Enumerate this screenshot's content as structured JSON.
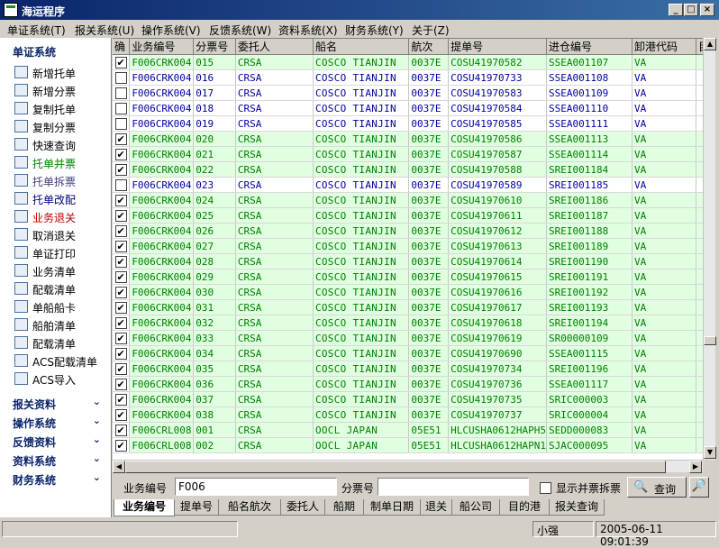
{
  "window": {
    "title": "海运程序"
  },
  "menu": [
    "单证系统(T)",
    "报关系统(U)",
    "操作系统(V)",
    "反馈系统(W)",
    "资料系统(X)",
    "财务系统(Y)",
    "关于(Z)"
  ],
  "sidebar": {
    "section_main": "单证系统",
    "items": [
      "新增托单",
      "新增分票",
      "复制托单",
      "复制分票",
      "快速查询",
      "托单并票",
      "托单拆票",
      "托单改配",
      "业务退关",
      "取消退关",
      "单证打印",
      "业务清单",
      "配载清单",
      "单船船卡",
      "船舶清单",
      "配载清单",
      "ACS配载清单",
      "ACS导入"
    ],
    "item_colors": [
      "#000000",
      "#000000",
      "#000000",
      "#000000",
      "#000000",
      "#008000",
      "#404080",
      "#000080",
      "#c00000",
      "#000000",
      "#000000",
      "#000000",
      "#000000",
      "#000000",
      "#000000",
      "#000000",
      "#000000",
      "#000000"
    ],
    "sections": [
      "报关资料",
      "操作系统",
      "反馈资料",
      "资料系统",
      "财务系统"
    ]
  },
  "grid": {
    "columns": [
      "确",
      "业务编号",
      "分票号",
      "委托人",
      "船名",
      "航次",
      "提单号",
      "进仓编号",
      "卸港代码",
      "目"
    ],
    "rows": [
      {
        "checked": true,
        "style": "green",
        "cells": [
          "F006CRK004",
          "015",
          "CRSA",
          "COSCO TIANJIN",
          "0037E",
          "COSU41970582",
          "SSEA001107",
          "VA"
        ]
      },
      {
        "checked": false,
        "style": "blue",
        "cells": [
          "F006CRK004",
          "016",
          "CRSA",
          "COSCO TIANJIN",
          "0037E",
          "COSU41970733",
          "SSEA001108",
          "VA"
        ]
      },
      {
        "checked": false,
        "style": "blue",
        "cells": [
          "F006CRK004",
          "017",
          "CRSA",
          "COSCO TIANJIN",
          "0037E",
          "COSU41970583",
          "SSEA001109",
          "VA"
        ]
      },
      {
        "checked": false,
        "style": "blue",
        "cells": [
          "F006CRK004",
          "018",
          "CRSA",
          "COSCO TIANJIN",
          "0037E",
          "COSU41970584",
          "SSEA001110",
          "VA"
        ]
      },
      {
        "checked": false,
        "style": "blue",
        "cells": [
          "F006CRK004",
          "019",
          "CRSA",
          "COSCO TIANJIN",
          "0037E",
          "COSU41970585",
          "SSEA001111",
          "VA"
        ]
      },
      {
        "checked": true,
        "style": "green",
        "cells": [
          "F006CRK004",
          "020",
          "CRSA",
          "COSCO TIANJIN",
          "0037E",
          "COSU41970586",
          "SSEA001113",
          "VA"
        ]
      },
      {
        "checked": true,
        "style": "green",
        "cells": [
          "F006CRK004",
          "021",
          "CRSA",
          "COSCO TIANJIN",
          "0037E",
          "COSU41970587",
          "SSEA001114",
          "VA"
        ]
      },
      {
        "checked": true,
        "style": "green",
        "cells": [
          "F006CRK004",
          "022",
          "CRSA",
          "COSCO TIANJIN",
          "0037E",
          "COSU41970588",
          "SREI001184",
          "VA"
        ]
      },
      {
        "checked": false,
        "style": "blue",
        "cells": [
          "F006CRK004",
          "023",
          "CRSA",
          "COSCO TIANJIN",
          "0037E",
          "COSU41970589",
          "SREI001185",
          "VA"
        ]
      },
      {
        "checked": true,
        "style": "green",
        "cells": [
          "F006CRK004",
          "024",
          "CRSA",
          "COSCO TIANJIN",
          "0037E",
          "COSU41970610",
          "SREI001186",
          "VA"
        ]
      },
      {
        "checked": true,
        "style": "green",
        "cells": [
          "F006CRK004",
          "025",
          "CRSA",
          "COSCO TIANJIN",
          "0037E",
          "COSU41970611",
          "SREI001187",
          "VA"
        ]
      },
      {
        "checked": true,
        "style": "green",
        "cells": [
          "F006CRK004",
          "026",
          "CRSA",
          "COSCO TIANJIN",
          "0037E",
          "COSU41970612",
          "SREI001188",
          "VA"
        ]
      },
      {
        "checked": true,
        "style": "green",
        "cells": [
          "F006CRK004",
          "027",
          "CRSA",
          "COSCO TIANJIN",
          "0037E",
          "COSU41970613",
          "SREI001189",
          "VA"
        ]
      },
      {
        "checked": true,
        "style": "green",
        "cells": [
          "F006CRK004",
          "028",
          "CRSA",
          "COSCO TIANJIN",
          "0037E",
          "COSU41970614",
          "SREI001190",
          "VA"
        ]
      },
      {
        "checked": true,
        "style": "green",
        "cells": [
          "F006CRK004",
          "029",
          "CRSA",
          "COSCO TIANJIN",
          "0037E",
          "COSU41970615",
          "SREI001191",
          "VA"
        ]
      },
      {
        "checked": true,
        "style": "green",
        "cells": [
          "F006CRK004",
          "030",
          "CRSA",
          "COSCO TIANJIN",
          "0037E",
          "COSU41970616",
          "SREI001192",
          "VA"
        ]
      },
      {
        "checked": true,
        "style": "green",
        "cells": [
          "F006CRK004",
          "031",
          "CRSA",
          "COSCO TIANJIN",
          "0037E",
          "COSU41970617",
          "SREI001193",
          "VA"
        ]
      },
      {
        "checked": true,
        "style": "green",
        "cells": [
          "F006CRK004",
          "032",
          "CRSA",
          "COSCO TIANJIN",
          "0037E",
          "COSU41970618",
          "SREI001194",
          "VA"
        ]
      },
      {
        "checked": true,
        "style": "green",
        "cells": [
          "F006CRK004",
          "033",
          "CRSA",
          "COSCO TIANJIN",
          "0037E",
          "COSU41970619",
          "SR00000109",
          "VA"
        ]
      },
      {
        "checked": true,
        "style": "green",
        "cells": [
          "F006CRK004",
          "034",
          "CRSA",
          "COSCO TIANJIN",
          "0037E",
          "COSU41970690",
          "SSEA001115",
          "VA"
        ]
      },
      {
        "checked": true,
        "style": "green",
        "cells": [
          "F006CRK004",
          "035",
          "CRSA",
          "COSCO TIANJIN",
          "0037E",
          "COSU41970734",
          "SREI001196",
          "VA"
        ]
      },
      {
        "checked": true,
        "style": "green",
        "cells": [
          "F006CRK004",
          "036",
          "CRSA",
          "COSCO TIANJIN",
          "0037E",
          "COSU41970736",
          "SSEA001117",
          "VA"
        ]
      },
      {
        "checked": true,
        "style": "green",
        "cells": [
          "F006CRK004",
          "037",
          "CRSA",
          "COSCO TIANJIN",
          "0037E",
          "COSU41970735",
          "SRIC000003",
          "VA"
        ]
      },
      {
        "checked": true,
        "style": "green",
        "cells": [
          "F006CRK004",
          "038",
          "CRSA",
          "COSCO TIANJIN",
          "0037E",
          "COSU41970737",
          "SRIC000004",
          "VA"
        ]
      },
      {
        "checked": true,
        "style": "green",
        "cells": [
          "F006CRL008",
          "001",
          "CRSA",
          "OOCL JAPAN",
          "05E51",
          "HLCUSHA0612HAPH5",
          "SEDD000083",
          "VA"
        ]
      },
      {
        "checked": true,
        "style": "green",
        "cells": [
          "F006CRL008",
          "002",
          "CRSA",
          "OOCL JAPAN",
          "05E51",
          "HLCUSHA0612HAPN1",
          "SJAC000095",
          "VA"
        ]
      }
    ]
  },
  "search": {
    "label_bizno": "业务编号",
    "bizno_value": "F006",
    "label_subno": "分票号",
    "subno_value": "",
    "merge_label": "显示并票拆票",
    "query_button": "查询"
  },
  "tabs": [
    "业务编号",
    "提单号",
    "船名航次",
    "委托人",
    "船期",
    "制单日期",
    "退关",
    "船公司",
    "目的港",
    "报关查询"
  ],
  "status": {
    "user": "小强",
    "datetime": "2005-06-11 09:01:39"
  }
}
